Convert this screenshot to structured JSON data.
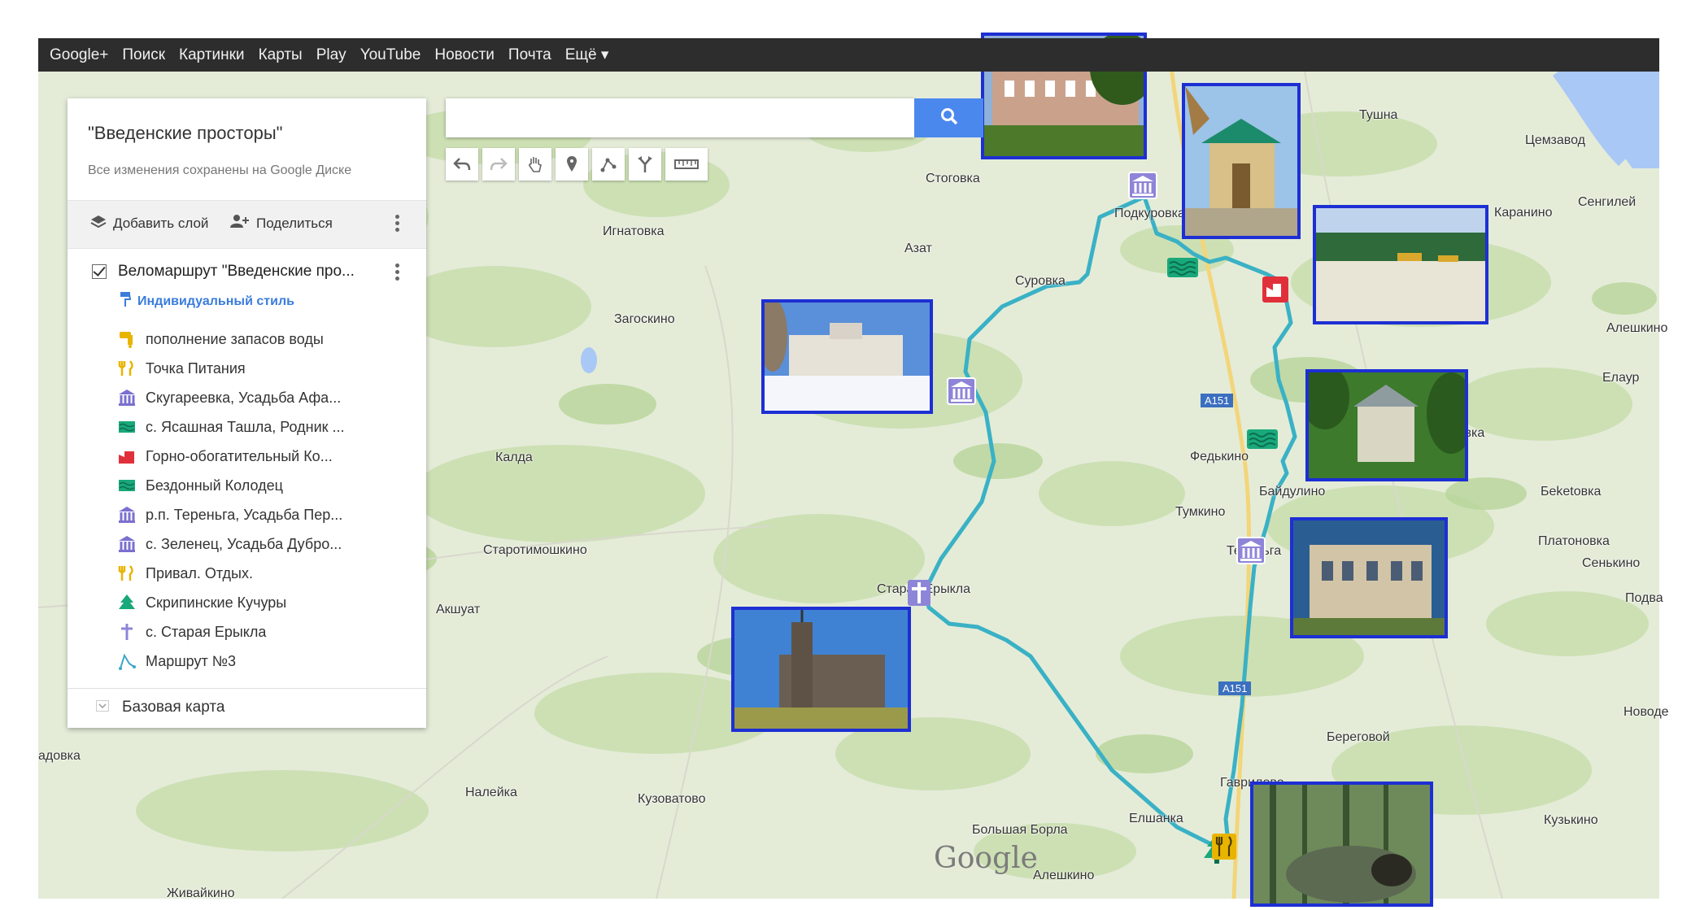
{
  "topbar": {
    "items": [
      "Google+",
      "Поиск",
      "Картинки",
      "Карты",
      "Play",
      "YouTube",
      "Новости",
      "Почта",
      "Ещё ▾"
    ]
  },
  "panel": {
    "title": "\"Введенские просторы\"",
    "saved": "Все изменения сохранены на Google Диске",
    "add_layer": "Добавить слой",
    "share": "Поделиться",
    "layer_name": "Веломаршрут \"Введенские про...",
    "style_label": "Индивидуальный стиль",
    "legend": [
      {
        "icon": "water-tap-icon",
        "color": "#e8b400",
        "label": "пополнение запасов воды"
      },
      {
        "icon": "fork-knife-icon",
        "color": "#e8b400",
        "label": "Точка Питания"
      },
      {
        "icon": "museum-icon",
        "color": "#7b6fcf",
        "label": "Скугареевка, Усадьба Афа..."
      },
      {
        "icon": "water-icon",
        "color": "#19a87a",
        "label": "с. Ясашная Ташла, Родник ..."
      },
      {
        "icon": "factory-icon",
        "color": "#e0313b",
        "label": "Горно-обогатительный Ко..."
      },
      {
        "icon": "water-icon",
        "color": "#19a87a",
        "label": "Бездонный Колодец"
      },
      {
        "icon": "museum-icon",
        "color": "#7b6fcf",
        "label": "р.п. Тереньга, Усадьба Пер..."
      },
      {
        "icon": "museum-icon",
        "color": "#7b6fcf",
        "label": "с. Зеленец, Усадьба Дубро..."
      },
      {
        "icon": "fork-knife-icon",
        "color": "#e8b400",
        "label": "Привал. Отдых."
      },
      {
        "icon": "tree-icon",
        "color": "#19a87a",
        "label": "Скрипинские Кучуры"
      },
      {
        "icon": "cross-icon",
        "color": "#8d86d8",
        "label": "с. Старая Ерыкла"
      },
      {
        "icon": "route-icon",
        "color": "#3ea7c7",
        "label": "Маршрут №3"
      }
    ],
    "basemap": "Базовая карта"
  },
  "search": {
    "placeholder": ""
  },
  "map": {
    "labels": [
      {
        "text": "Тушна"
      },
      {
        "text": "Цемзавод"
      },
      {
        "text": "Сенгилей"
      },
      {
        "text": "Каранино"
      },
      {
        "text": "Стоговка"
      },
      {
        "text": "Игнатовка"
      },
      {
        "text": "Азат"
      },
      {
        "text": "Подкуровка"
      },
      {
        "text": "Суровка"
      },
      {
        "text": "Загоскино"
      },
      {
        "text": "Алешкино"
      },
      {
        "text": "Елаур"
      },
      {
        "text": "Калда"
      },
      {
        "text": "Федькино"
      },
      {
        "text": "Байдулино"
      },
      {
        "text": "Головка"
      },
      {
        "text": "Тумкино"
      },
      {
        "text": "Беketовка"
      },
      {
        "text": "Старотимошкино"
      },
      {
        "text": "Тереньга"
      },
      {
        "text": "Платоновка"
      },
      {
        "text": "Сенькино"
      },
      {
        "text": "Старая Ерыкла"
      },
      {
        "text": "Акшуат"
      },
      {
        "text": "Подва"
      },
      {
        "text": "Новоде"
      },
      {
        "text": "Береговой"
      },
      {
        "text": "Гаврилово"
      },
      {
        "text": "Налейка"
      },
      {
        "text": "Кузоватово"
      },
      {
        "text": "Елшанка"
      },
      {
        "text": "Большая Борла"
      },
      {
        "text": "Алешкино"
      },
      {
        "text": "Кузькино"
      },
      {
        "text": "Живайкино"
      },
      {
        "text": "адовка"
      }
    ],
    "road_labels": [
      "A151",
      "A151"
    ],
    "watermark": "Google"
  }
}
